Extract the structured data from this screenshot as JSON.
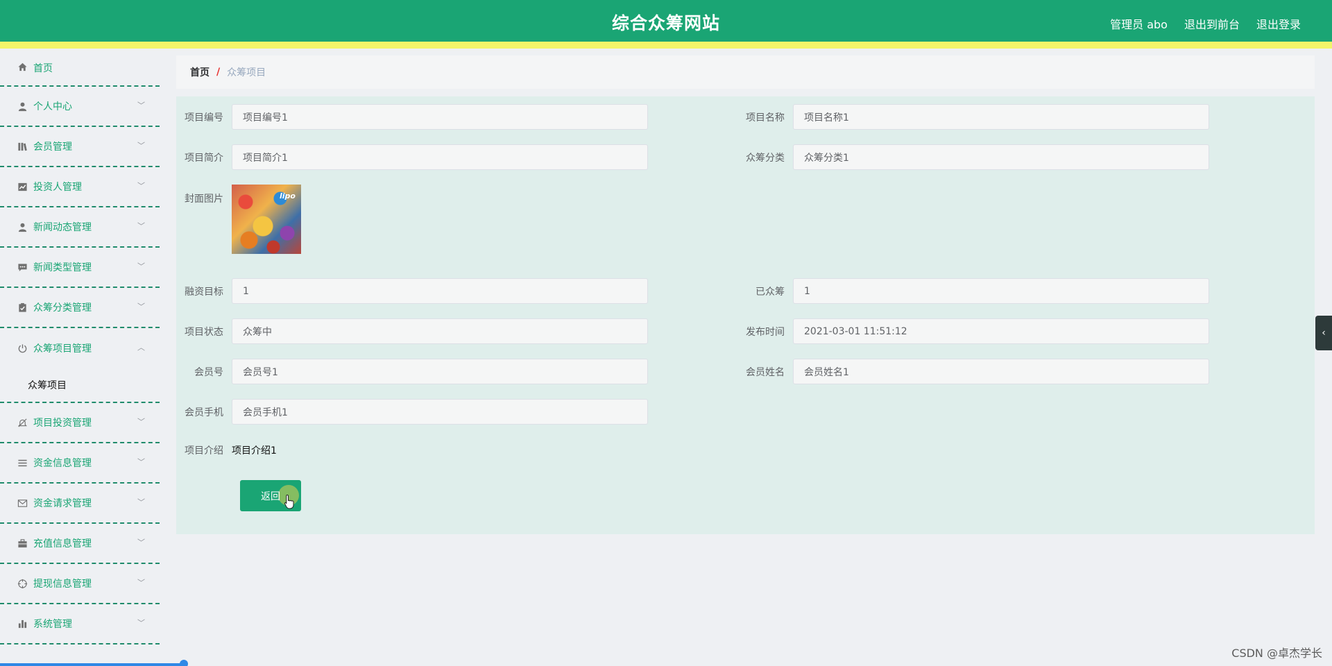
{
  "header": {
    "title": "综合众筹网站",
    "links": [
      "管理员 abo",
      "退出到前台",
      "退出登录"
    ]
  },
  "sidebar": {
    "items": [
      {
        "label": "首页",
        "icon": "home-icon"
      },
      {
        "label": "个人中心",
        "icon": "user-icon"
      },
      {
        "label": "会员管理",
        "icon": "library-icon"
      },
      {
        "label": "投资人管理",
        "icon": "chart-icon"
      },
      {
        "label": "新闻动态管理",
        "icon": "person-icon"
      },
      {
        "label": "新闻类型管理",
        "icon": "chat-icon"
      },
      {
        "label": "众筹分类管理",
        "icon": "clipboard-icon"
      },
      {
        "label": "众筹项目管理",
        "icon": "power-icon",
        "expanded": true,
        "sub": [
          "众筹项目"
        ]
      },
      {
        "label": "项目投资管理",
        "icon": "bell-off-icon"
      },
      {
        "label": "资金信息管理",
        "icon": "list-icon"
      },
      {
        "label": "资金请求管理",
        "icon": "mail-icon"
      },
      {
        "label": "充值信息管理",
        "icon": "briefcase-icon"
      },
      {
        "label": "提现信息管理",
        "icon": "target-icon"
      },
      {
        "label": "系统管理",
        "icon": "bar-chart-icon"
      }
    ]
  },
  "breadcrumb": {
    "home": "首页",
    "separator": "/",
    "current": "众筹项目"
  },
  "form": {
    "project_no": {
      "label": "项目编号",
      "value": "项目编号1"
    },
    "project_name": {
      "label": "项目名称",
      "value": "项目名称1"
    },
    "project_summary": {
      "label": "项目简介",
      "value": "项目简介1"
    },
    "category": {
      "label": "众筹分类",
      "value": "众筹分类1"
    },
    "cover": {
      "label": "封面图片",
      "image_text": "lipo"
    },
    "funding_goal": {
      "label": "融资目标",
      "value": "1"
    },
    "raised": {
      "label": "已众筹",
      "value": "1"
    },
    "status": {
      "label": "项目状态",
      "value": "众筹中"
    },
    "publish_time": {
      "label": "发布时间",
      "value": "2021-03-01 11:51:12"
    },
    "member_no": {
      "label": "会员号",
      "value": "会员号1"
    },
    "member_name": {
      "label": "会员姓名",
      "value": "会员姓名1"
    },
    "member_phone": {
      "label": "会员手机",
      "value": "会员手机1"
    },
    "intro": {
      "label": "项目介绍",
      "value": "项目介绍1"
    },
    "back_button": "返回"
  },
  "side_toggle_icon": "chevron-left-icon",
  "watermark": "CSDN @卓杰学长",
  "colors": {
    "primary": "#1aa574",
    "accent_strip": "#f2f56a",
    "panel_bg": "#dfeeeb",
    "page_bg": "#eef0f3"
  }
}
